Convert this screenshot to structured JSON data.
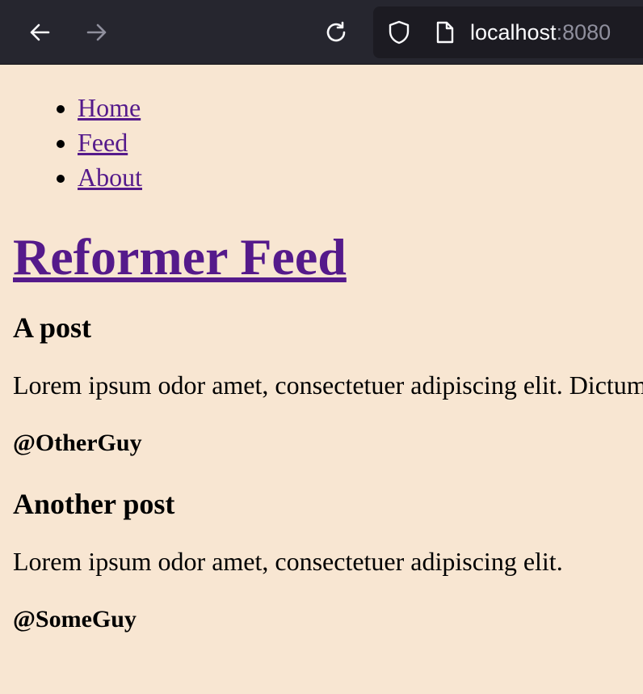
{
  "browser": {
    "url_host": "localhost",
    "url_port": ":8080",
    "icons": [
      "back-arrow-icon",
      "forward-arrow-icon",
      "reload-icon",
      "shield-icon",
      "page-icon"
    ]
  },
  "page": {
    "nav": [
      {
        "label": "Home"
      },
      {
        "label": "Feed"
      },
      {
        "label": "About"
      }
    ],
    "title": "Reformer Feed",
    "posts": [
      {
        "title": "A post",
        "body": "Lorem ipsum odor amet, consectetuer adipiscing elit. Dictum",
        "author": "@OtherGuy"
      },
      {
        "title": "Another post",
        "body": "Lorem ipsum odor amet, consectetuer adipiscing elit.",
        "author": "@SomeGuy"
      }
    ]
  },
  "colors": {
    "page_background": "#f8e6d2",
    "link": "#551a8b",
    "toolbar": "#26262f",
    "urlbar": "#1c1b22"
  }
}
